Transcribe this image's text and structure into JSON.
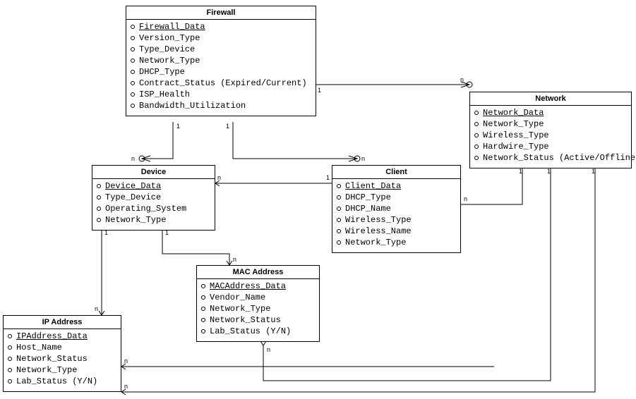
{
  "entities": {
    "firewall": {
      "title": "Firewall",
      "attrs": [
        {
          "t": "Firewall_Data",
          "pk": true
        },
        {
          "t": "Version_Type"
        },
        {
          "t": "Type_Device"
        },
        {
          "t": "Network_Type"
        },
        {
          "t": "DHCP_Type"
        },
        {
          "t": "Contract_Status (Expired/Current)"
        },
        {
          "t": "ISP_Health"
        },
        {
          "t": "Bandwidth_Utilization"
        }
      ]
    },
    "network": {
      "title": "Network",
      "attrs": [
        {
          "t": "Network_Data",
          "pk": true
        },
        {
          "t": "Network_Type"
        },
        {
          "t": "Wireless_Type"
        },
        {
          "t": "Hardwire_Type"
        },
        {
          "t": "Network_Status (Active/Offline)"
        }
      ]
    },
    "device": {
      "title": "Device",
      "attrs": [
        {
          "t": "Device_Data",
          "pk": true
        },
        {
          "t": "Type_Device"
        },
        {
          "t": "Operating_System"
        },
        {
          "t": "Network_Type"
        }
      ]
    },
    "client": {
      "title": "Client",
      "attrs": [
        {
          "t": "Client_Data",
          "pk": true
        },
        {
          "t": "DHCP_Type"
        },
        {
          "t": "DHCP_Name"
        },
        {
          "t": "Wireless_Type"
        },
        {
          "t": "Wireless_Name"
        },
        {
          "t": "Network_Type"
        }
      ]
    },
    "mac": {
      "title": "MAC Address",
      "attrs": [
        {
          "t": "MACAddress_Data",
          "pk": true
        },
        {
          "t": "Vendor_Name"
        },
        {
          "t": "Network_Type"
        },
        {
          "t": "Network_Status"
        },
        {
          "t": "Lab_Status (Y/N)"
        }
      ]
    },
    "ip": {
      "title": "IP Address",
      "attrs": [
        {
          "t": "IPAddress_Data",
          "pk": true
        },
        {
          "t": "Host_Name"
        },
        {
          "t": "Network_Status"
        },
        {
          "t": "Network_Type"
        },
        {
          "t": "Lab_Status (Y/N)"
        }
      ]
    }
  },
  "mults": {
    "fw_l_1": "1",
    "fw_r_1": "1",
    "fw_rt_1": "1",
    "nw_t_n": "n",
    "nw_b1_1": "1",
    "nw_b2_1": "1",
    "nw_b3_1": "1",
    "dev_t_n": "n",
    "dev_r_n": "n",
    "dev_bl_1": "1",
    "dev_br_1": "1",
    "cli_t_n": "n",
    "cli_l_1": "1",
    "cli_r_n": "n",
    "mac_t_n": "n",
    "mac_b_n": "n",
    "ip_t_n": "n",
    "ip_r1_n": "n",
    "ip_r2_n": "n"
  }
}
